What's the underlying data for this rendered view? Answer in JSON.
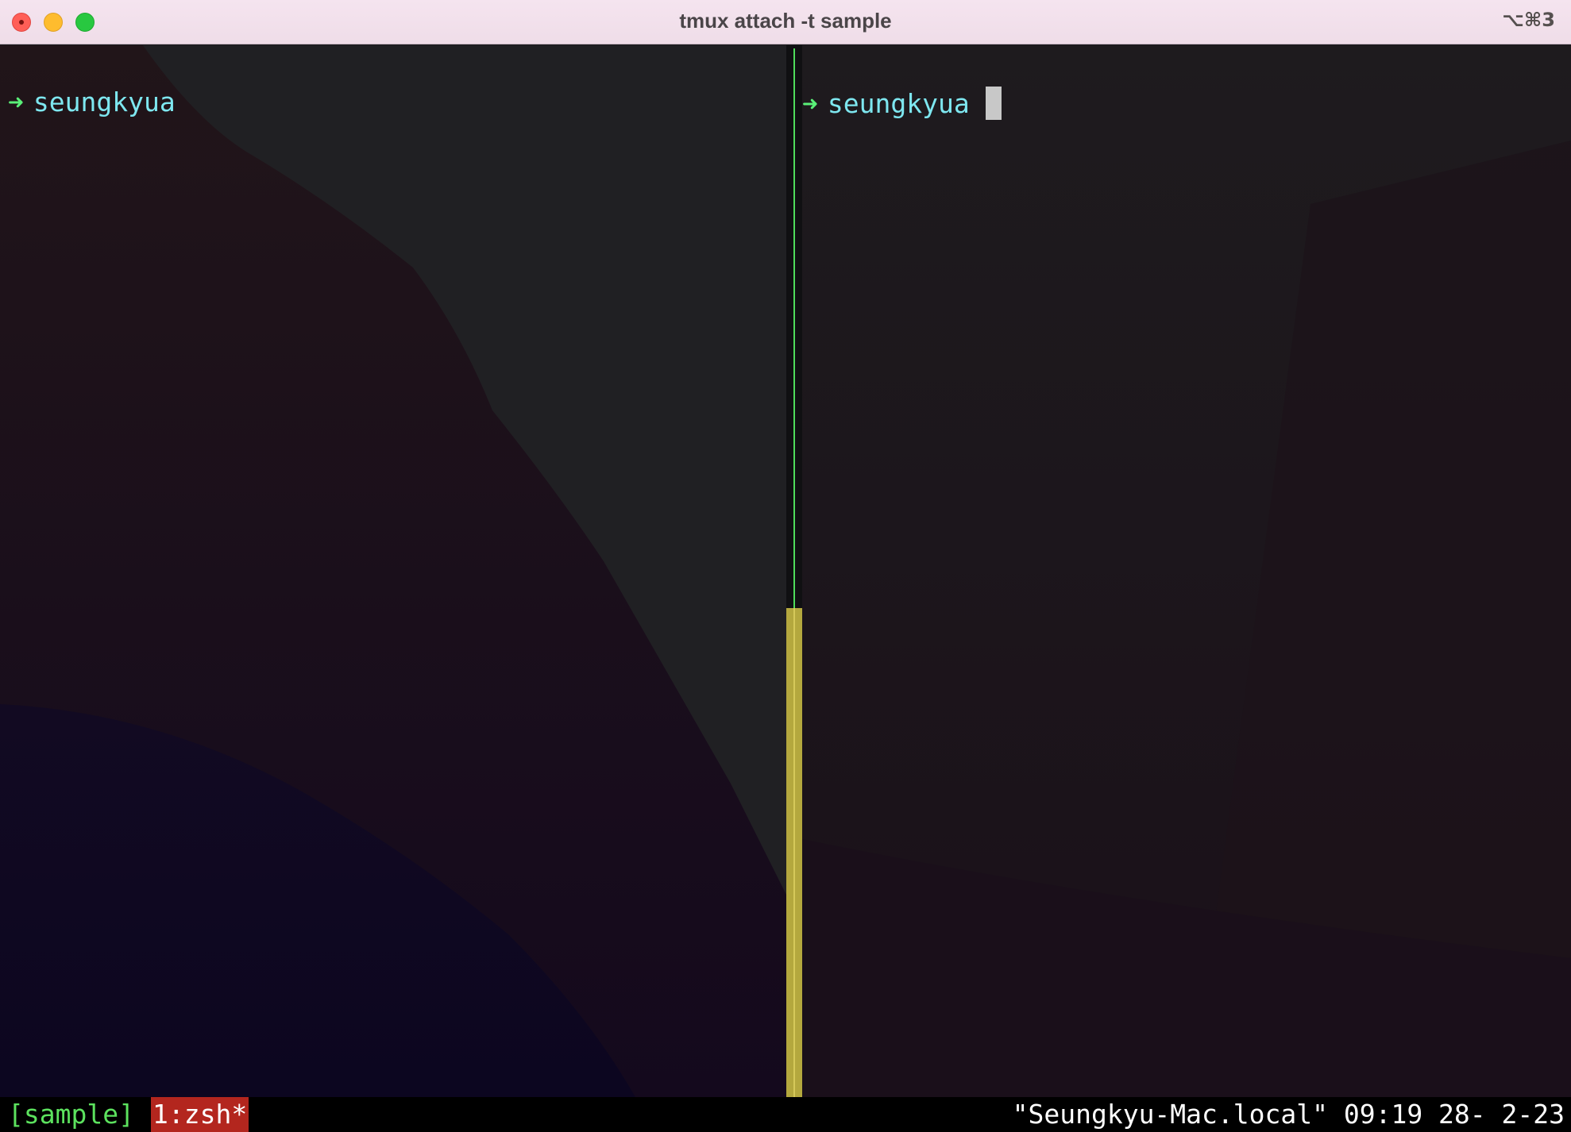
{
  "window": {
    "title": "tmux attach -t sample",
    "shortcut": "⌥⌘3"
  },
  "panes": {
    "left": {
      "arrow": "➜",
      "user": "seungkyua"
    },
    "right": {
      "arrow": "➜",
      "user": "seungkyua"
    }
  },
  "statusbar": {
    "session": "[sample]",
    "window_tab": "1:zsh*",
    "right": "\"Seungkyu-Mac.local\" 09:19 28- 2-23"
  },
  "colors": {
    "prompt_arrow": "#5af078",
    "prompt_user": "#7ee7f0",
    "active_border": "#4fdc5a",
    "window_tab_bg": "#b3261e",
    "session_text": "#5ce25e"
  }
}
